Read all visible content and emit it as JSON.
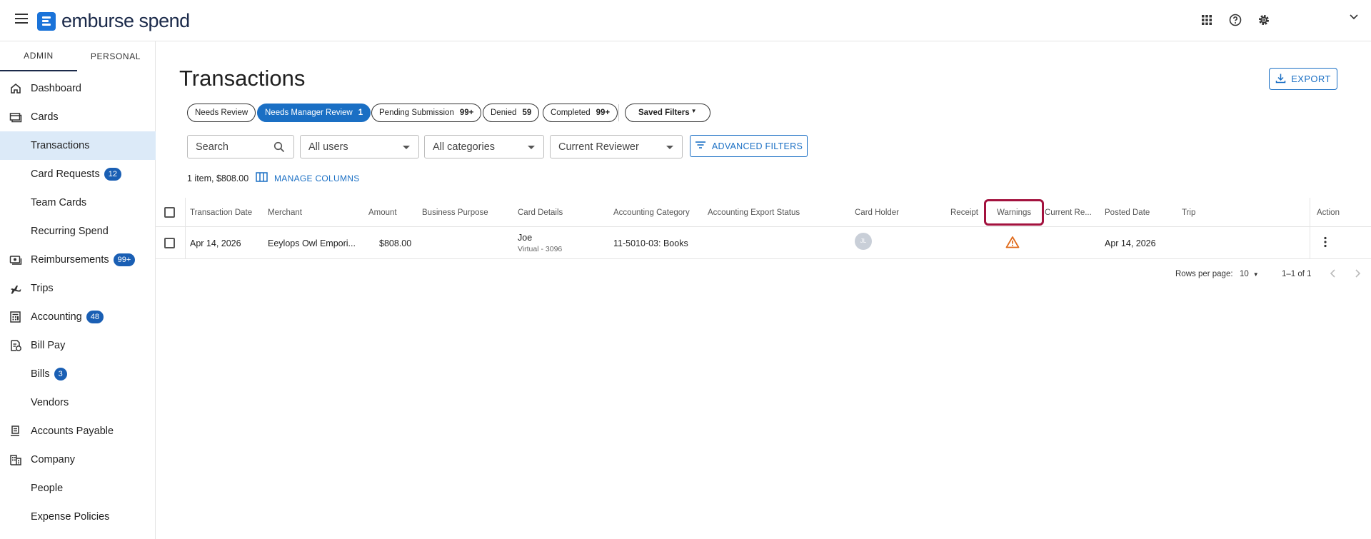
{
  "app": {
    "brand": "emburse spend",
    "brand_color": "#1a73d9",
    "accent": "#1a6fc4"
  },
  "sidebar": {
    "tabs": [
      "ADMIN",
      "PERSONAL"
    ],
    "items": [
      {
        "label": "Dashboard",
        "icon": "home-icon"
      },
      {
        "label": "Cards",
        "icon": "cards-icon"
      },
      {
        "label": "Transactions"
      },
      {
        "label": "Card Requests",
        "badge": "12"
      },
      {
        "label": "Team Cards"
      },
      {
        "label": "Recurring Spend"
      },
      {
        "label": "Reimbursements",
        "badge": "99+",
        "icon": "reimbursements-icon"
      },
      {
        "label": "Trips",
        "icon": "plane-icon"
      },
      {
        "label": "Accounting",
        "badge": "48",
        "icon": "accounting-icon"
      },
      {
        "label": "Bill Pay",
        "icon": "bill-pay-icon"
      },
      {
        "label": "Bills",
        "badge": "3"
      },
      {
        "label": "Vendors"
      },
      {
        "label": "Accounts Payable",
        "icon": "accounts-payable-icon"
      },
      {
        "label": "Company",
        "icon": "company-icon"
      },
      {
        "label": "People"
      },
      {
        "label": "Expense Policies"
      }
    ]
  },
  "page": {
    "title": "Transactions",
    "export_label": "EXPORT",
    "chips": [
      {
        "label": "Needs Review",
        "count": ""
      },
      {
        "label": "Needs Manager Review",
        "count": "1"
      },
      {
        "label": "Pending Submission",
        "count": "99+"
      },
      {
        "label": "Denied",
        "count": "59"
      },
      {
        "label": "Completed",
        "count": "99+"
      }
    ],
    "saved_filters": "Saved Filters",
    "search_placeholder": "Search",
    "filters": {
      "users": "All users",
      "categories": "All categories",
      "reviewer": "Current Reviewer"
    },
    "advanced_filters": "ADVANCED FILTERS",
    "summary": "1 item, $808.00",
    "manage_columns": "MANAGE COLUMNS"
  },
  "table": {
    "columns": [
      "Transaction Date",
      "Merchant",
      "Amount",
      "Business Purpose",
      "Card Details",
      "Accounting Category",
      "Accounting Export Status",
      "Card Holder",
      "Receipt",
      "Warnings",
      "Current Re...",
      "Posted Date",
      "Trip",
      "Action"
    ],
    "rows": [
      {
        "transaction_date": "Apr 14, 2026",
        "merchant": "Eeylops Owl Empori...",
        "amount": "$808.00",
        "business_purpose": "",
        "card_holder_name": "Joe",
        "card_sub": "Virtual - 3096",
        "accounting_category": "11-5010-03: Books",
        "accounting_export_status": "",
        "avatar_initials": "JL",
        "warning_icon": "warning-icon",
        "posted_date": "Apr 14, 2026"
      }
    ]
  },
  "pagination": {
    "rows_label": "Rows per page:",
    "rows_value": "10",
    "range": "1–1 of 1"
  }
}
